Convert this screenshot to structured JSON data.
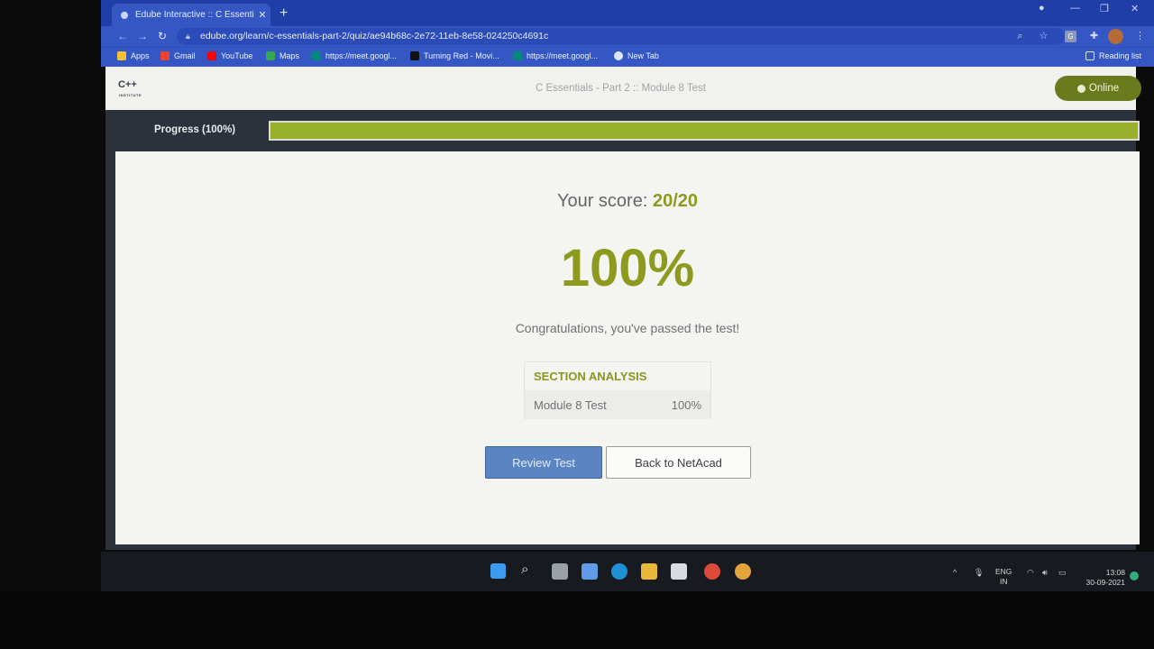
{
  "browser": {
    "tab_title": "Edube Interactive :: C Essentials ·",
    "url": "edube.org/learn/c-essentials-part-2/quiz/ae94b68c-2e72-11eb-8e58-024250c4691c",
    "bookmarks": [
      {
        "label": "Apps",
        "icon": "apps-grid-icon",
        "color": "#f1c232"
      },
      {
        "label": "Gmail",
        "icon": "gmail-icon",
        "color": "#ea4335"
      },
      {
        "label": "YouTube",
        "icon": "youtube-icon",
        "color": "#ff0000"
      },
      {
        "label": "Maps",
        "icon": "maps-icon",
        "color": "#34a853"
      },
      {
        "label": "https://meet.googl...",
        "icon": "meet-icon",
        "color": "#00897b"
      },
      {
        "label": "Turning Red - Movi...",
        "icon": "n-icon",
        "color": "#111111"
      },
      {
        "label": "https://meet.googl...",
        "icon": "meet-icon",
        "color": "#00897b"
      },
      {
        "label": "New Tab",
        "icon": "globe-icon",
        "color": "#dfe6ff"
      }
    ],
    "reading_list": "Reading list"
  },
  "site": {
    "logo_text": "C++",
    "logo_sub": "INSTITUTE",
    "course_title": "C Essentials - Part 2 :: Module 8 Test",
    "status": "Online"
  },
  "progress": {
    "label": "Progress (100%)",
    "value": 1.0
  },
  "result": {
    "score_label": "Your score:",
    "score_value": "20/20",
    "percent": "100%",
    "message": "Congratulations, you've passed the test!",
    "section_heading": "SECTION ANALYSIS",
    "sections": [
      {
        "name": "Module 8 Test",
        "value": "100%"
      }
    ],
    "review_button": "Review Test",
    "back_button": "Back to NetAcad"
  },
  "taskbar": {
    "lang_line1": "ENG",
    "lang_line2": "IN",
    "time": "13:08",
    "date": "30-09-2021"
  },
  "colors": {
    "accent_green": "#8d9a1f",
    "progress_fill": "#99b02c",
    "button_blue": "#5b84c2",
    "chrome_blue": "#3457c4"
  }
}
